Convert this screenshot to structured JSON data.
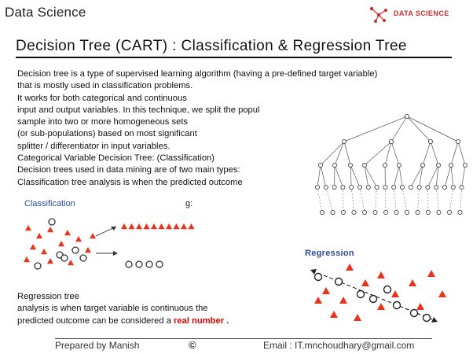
{
  "header": {
    "title": "Data Science",
    "logo_text": "DATA SCIENCE"
  },
  "slide": {
    "title": "Decision Tree (CART) : Classification & Regression Tree",
    "body_lines": [
      "Decision tree is a type of supervised learning algorithm (having a pre-defined target variable)",
      "that is mostly used in classification problems.",
      " It works for both categorical and continuous",
      "input and output variables. In this technique, we split the popul",
      "sample into two or more homogeneous sets",
      "(or sub-populations) based on most significant",
      "splitter / differentiator in input variables.",
      "Categorical Variable Decision Tree: (Classification)",
      "Decision trees used in data mining are of two main types:",
      "Classification tree analysis is when the predicted outcome"
    ],
    "line_11_tail": "g:",
    "classification_label": "Classification",
    "regression_label": "Regression",
    "bottom_lines": [
      "Regression tree",
      "analysis is when target variable is continuous the"
    ],
    "bottom_last_prefix": "predicted outcome can be considered a ",
    "bottom_last_highlight": "real number ."
  },
  "footer": {
    "prepared_by": "Prepared by Manish",
    "copyright_symbol": "©",
    "email": "Email : IT.mnchoudhary@gmail.com"
  },
  "colors": {
    "accent_red": "#e00000",
    "logo_red": "#c9302c",
    "label_blue": "#2a4a9a",
    "triangle_red": "#e8341c"
  },
  "icons": [
    "data-science-logo-icon",
    "arrow-right-icon",
    "decision-tree-diagram",
    "regression-scatter-diagram"
  ]
}
